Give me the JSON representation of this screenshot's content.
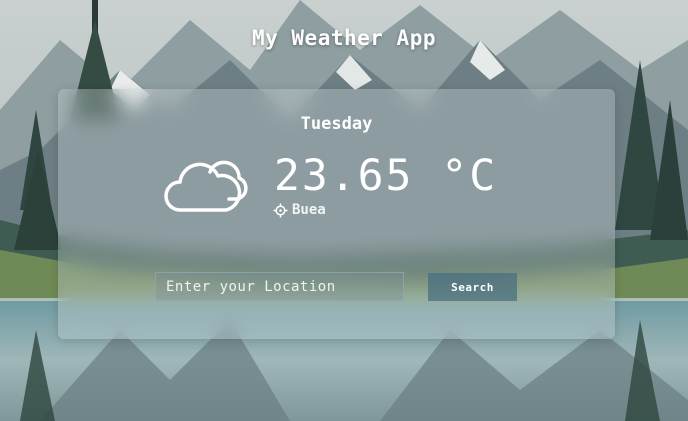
{
  "app": {
    "title": "My Weather App"
  },
  "weather": {
    "day": "Tuesday",
    "temperature": "23.65 °C",
    "location": "Buea",
    "condition_icon": "cloud-icon",
    "location_icon": "crosshair-icon"
  },
  "search": {
    "placeholder": "Enter your Location",
    "value": "",
    "button_label": "Search"
  },
  "colors": {
    "text": "#ffffff",
    "card_bg": "rgba(205,215,218,0.34)",
    "button_bg": "#466e80"
  }
}
